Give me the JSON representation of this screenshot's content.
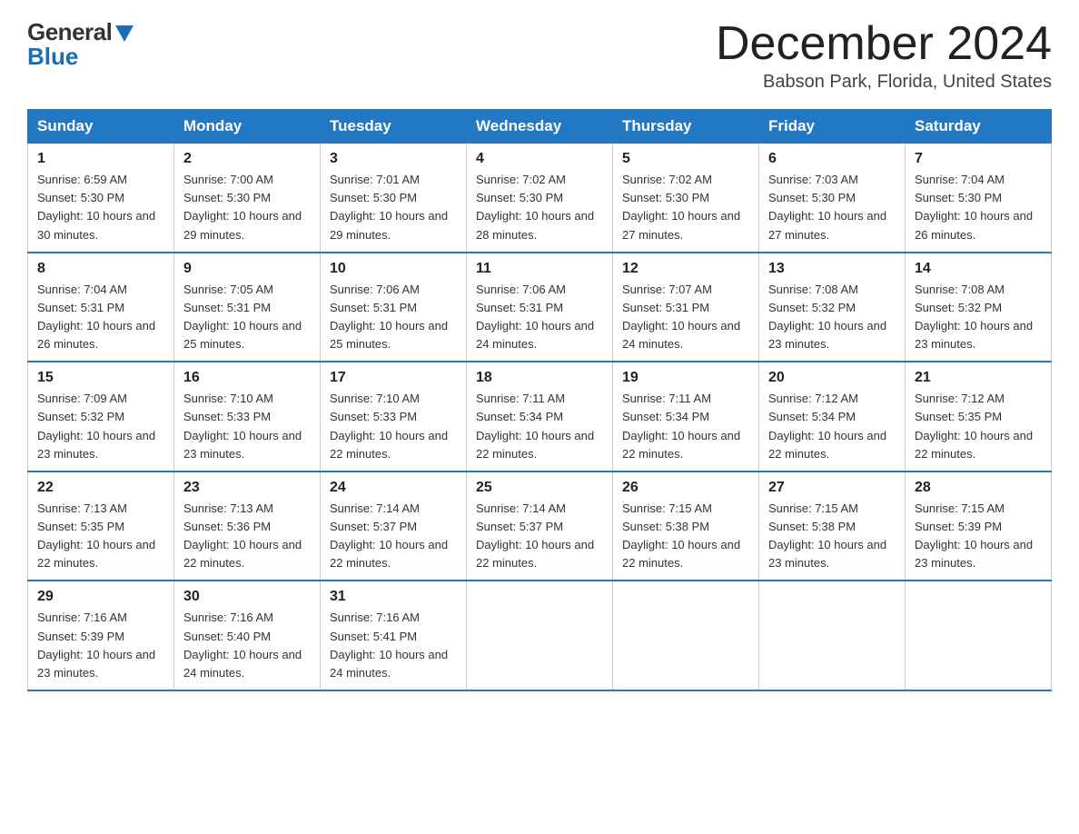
{
  "logo": {
    "general_text": "General",
    "blue_text": "Blue"
  },
  "header": {
    "month_year": "December 2024",
    "location": "Babson Park, Florida, United States"
  },
  "days_of_week": [
    "Sunday",
    "Monday",
    "Tuesday",
    "Wednesday",
    "Thursday",
    "Friday",
    "Saturday"
  ],
  "weeks": [
    [
      {
        "day": "1",
        "sunrise": "6:59 AM",
        "sunset": "5:30 PM",
        "daylight": "10 hours and 30 minutes."
      },
      {
        "day": "2",
        "sunrise": "7:00 AM",
        "sunset": "5:30 PM",
        "daylight": "10 hours and 29 minutes."
      },
      {
        "day": "3",
        "sunrise": "7:01 AM",
        "sunset": "5:30 PM",
        "daylight": "10 hours and 29 minutes."
      },
      {
        "day": "4",
        "sunrise": "7:02 AM",
        "sunset": "5:30 PM",
        "daylight": "10 hours and 28 minutes."
      },
      {
        "day": "5",
        "sunrise": "7:02 AM",
        "sunset": "5:30 PM",
        "daylight": "10 hours and 27 minutes."
      },
      {
        "day": "6",
        "sunrise": "7:03 AM",
        "sunset": "5:30 PM",
        "daylight": "10 hours and 27 minutes."
      },
      {
        "day": "7",
        "sunrise": "7:04 AM",
        "sunset": "5:30 PM",
        "daylight": "10 hours and 26 minutes."
      }
    ],
    [
      {
        "day": "8",
        "sunrise": "7:04 AM",
        "sunset": "5:31 PM",
        "daylight": "10 hours and 26 minutes."
      },
      {
        "day": "9",
        "sunrise": "7:05 AM",
        "sunset": "5:31 PM",
        "daylight": "10 hours and 25 minutes."
      },
      {
        "day": "10",
        "sunrise": "7:06 AM",
        "sunset": "5:31 PM",
        "daylight": "10 hours and 25 minutes."
      },
      {
        "day": "11",
        "sunrise": "7:06 AM",
        "sunset": "5:31 PM",
        "daylight": "10 hours and 24 minutes."
      },
      {
        "day": "12",
        "sunrise": "7:07 AM",
        "sunset": "5:31 PM",
        "daylight": "10 hours and 24 minutes."
      },
      {
        "day": "13",
        "sunrise": "7:08 AM",
        "sunset": "5:32 PM",
        "daylight": "10 hours and 23 minutes."
      },
      {
        "day": "14",
        "sunrise": "7:08 AM",
        "sunset": "5:32 PM",
        "daylight": "10 hours and 23 minutes."
      }
    ],
    [
      {
        "day": "15",
        "sunrise": "7:09 AM",
        "sunset": "5:32 PM",
        "daylight": "10 hours and 23 minutes."
      },
      {
        "day": "16",
        "sunrise": "7:10 AM",
        "sunset": "5:33 PM",
        "daylight": "10 hours and 23 minutes."
      },
      {
        "day": "17",
        "sunrise": "7:10 AM",
        "sunset": "5:33 PM",
        "daylight": "10 hours and 22 minutes."
      },
      {
        "day": "18",
        "sunrise": "7:11 AM",
        "sunset": "5:34 PM",
        "daylight": "10 hours and 22 minutes."
      },
      {
        "day": "19",
        "sunrise": "7:11 AM",
        "sunset": "5:34 PM",
        "daylight": "10 hours and 22 minutes."
      },
      {
        "day": "20",
        "sunrise": "7:12 AM",
        "sunset": "5:34 PM",
        "daylight": "10 hours and 22 minutes."
      },
      {
        "day": "21",
        "sunrise": "7:12 AM",
        "sunset": "5:35 PM",
        "daylight": "10 hours and 22 minutes."
      }
    ],
    [
      {
        "day": "22",
        "sunrise": "7:13 AM",
        "sunset": "5:35 PM",
        "daylight": "10 hours and 22 minutes."
      },
      {
        "day": "23",
        "sunrise": "7:13 AM",
        "sunset": "5:36 PM",
        "daylight": "10 hours and 22 minutes."
      },
      {
        "day": "24",
        "sunrise": "7:14 AM",
        "sunset": "5:37 PM",
        "daylight": "10 hours and 22 minutes."
      },
      {
        "day": "25",
        "sunrise": "7:14 AM",
        "sunset": "5:37 PM",
        "daylight": "10 hours and 22 minutes."
      },
      {
        "day": "26",
        "sunrise": "7:15 AM",
        "sunset": "5:38 PM",
        "daylight": "10 hours and 22 minutes."
      },
      {
        "day": "27",
        "sunrise": "7:15 AM",
        "sunset": "5:38 PM",
        "daylight": "10 hours and 23 minutes."
      },
      {
        "day": "28",
        "sunrise": "7:15 AM",
        "sunset": "5:39 PM",
        "daylight": "10 hours and 23 minutes."
      }
    ],
    [
      {
        "day": "29",
        "sunrise": "7:16 AM",
        "sunset": "5:39 PM",
        "daylight": "10 hours and 23 minutes."
      },
      {
        "day": "30",
        "sunrise": "7:16 AM",
        "sunset": "5:40 PM",
        "daylight": "10 hours and 24 minutes."
      },
      {
        "day": "31",
        "sunrise": "7:16 AM",
        "sunset": "5:41 PM",
        "daylight": "10 hours and 24 minutes."
      },
      null,
      null,
      null,
      null
    ]
  ]
}
